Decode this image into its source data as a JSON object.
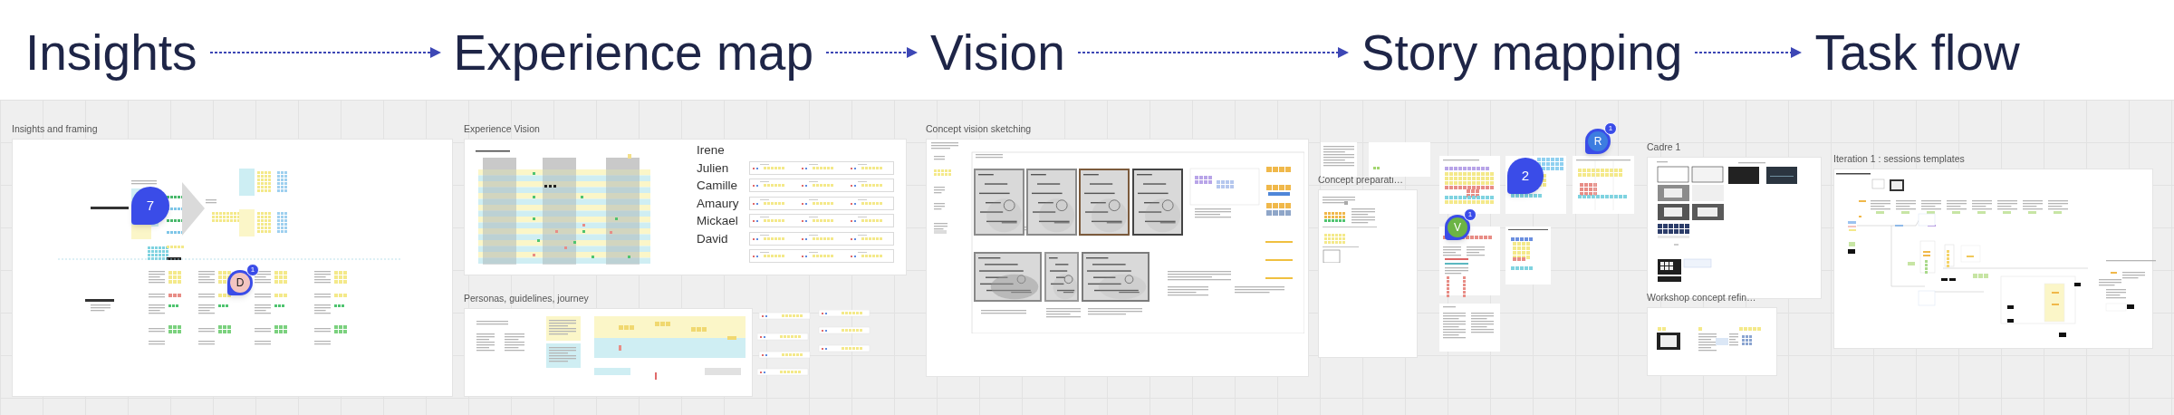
{
  "header": {
    "steps": [
      {
        "label": "Insights"
      },
      {
        "label": "Experience map"
      },
      {
        "label": "Vision"
      },
      {
        "label": "Story mapping"
      },
      {
        "label": "Task flow"
      }
    ]
  },
  "frames": [
    {
      "title": "Insights and framing"
    },
    {
      "title": "Experience Vision"
    },
    {
      "title": "Personas, guidelines, journey"
    },
    {
      "title": "Concept vision sketching"
    },
    {
      "title": "Concept preparati…"
    },
    {
      "title": "Cadre 1"
    },
    {
      "title": "Workshop concept refin…"
    },
    {
      "title": "Iteration 1 : sessions templates"
    }
  ],
  "names": [
    "Irene",
    "Julien",
    "Camille",
    "Amaury",
    "Mickael",
    "David"
  ],
  "comments": [
    {
      "kind": "count",
      "label": "7"
    },
    {
      "kind": "avatar",
      "label": "D",
      "color": "#f3c5c1",
      "badge": "1"
    },
    {
      "kind": "count",
      "label": "2"
    },
    {
      "kind": "avatar",
      "label": "R",
      "color": "#3d7de0",
      "badge": "1"
    },
    {
      "kind": "avatar",
      "label": "V",
      "color": "#6cb445",
      "badge": "1"
    }
  ]
}
